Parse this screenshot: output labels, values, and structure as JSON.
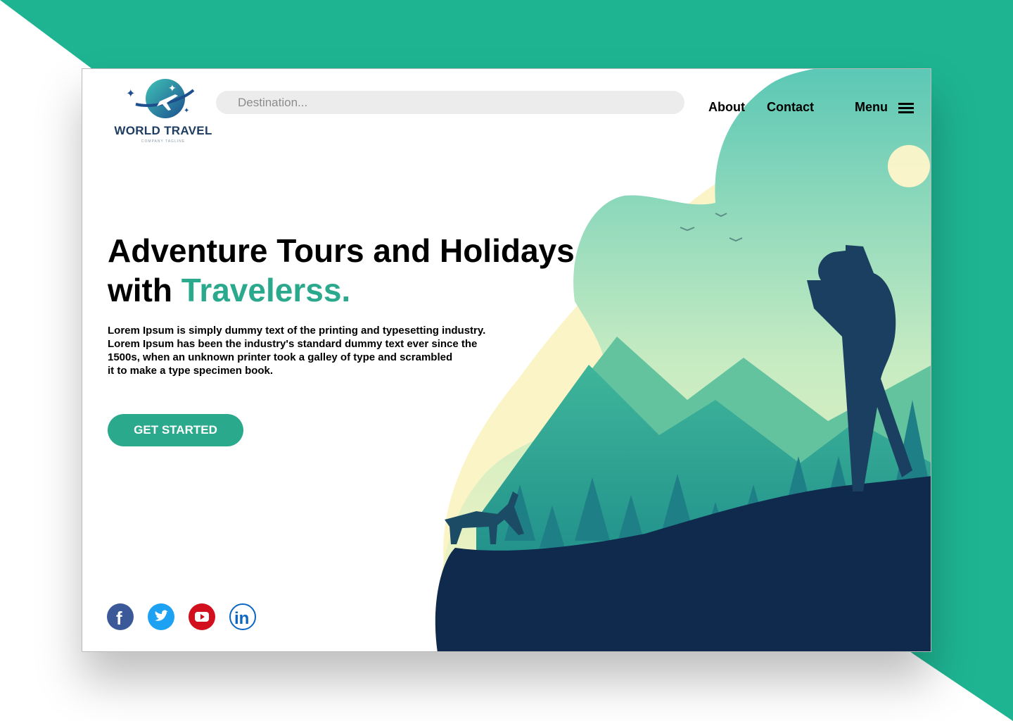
{
  "brand": {
    "name": "WORLD TRAVEL",
    "tagline": "COMPANY TAGLINE"
  },
  "search": {
    "placeholder": "Destination..."
  },
  "nav": {
    "about": "About",
    "contact": "Contact",
    "menu": "Menu"
  },
  "hero": {
    "headline_line1": "Adventure Tours and Holidays",
    "headline_prefix": "with ",
    "headline_accent": "Travelerss.",
    "description": "Lorem Ipsum is simply dummy text of the printing and typesetting industry.\nLorem Ipsum has been the industry's standard dummy text ever since the\n1500s, when an unknown printer took a galley of type and scrambled\n it to make a type specimen book.",
    "cta": "GET STARTED"
  },
  "social": [
    {
      "name": "facebook-icon",
      "color": "#3b5998"
    },
    {
      "name": "twitter-icon",
      "color": "#1da1f2"
    },
    {
      "name": "youtube-icon",
      "color": "#d20f1c"
    },
    {
      "name": "linkedin-icon",
      "color": "#0a66c2"
    }
  ],
  "colors": {
    "accent": "#2aa98d",
    "frame": "#1eb492",
    "navy": "#0f2a4d",
    "cream": "#fbf4c7"
  }
}
